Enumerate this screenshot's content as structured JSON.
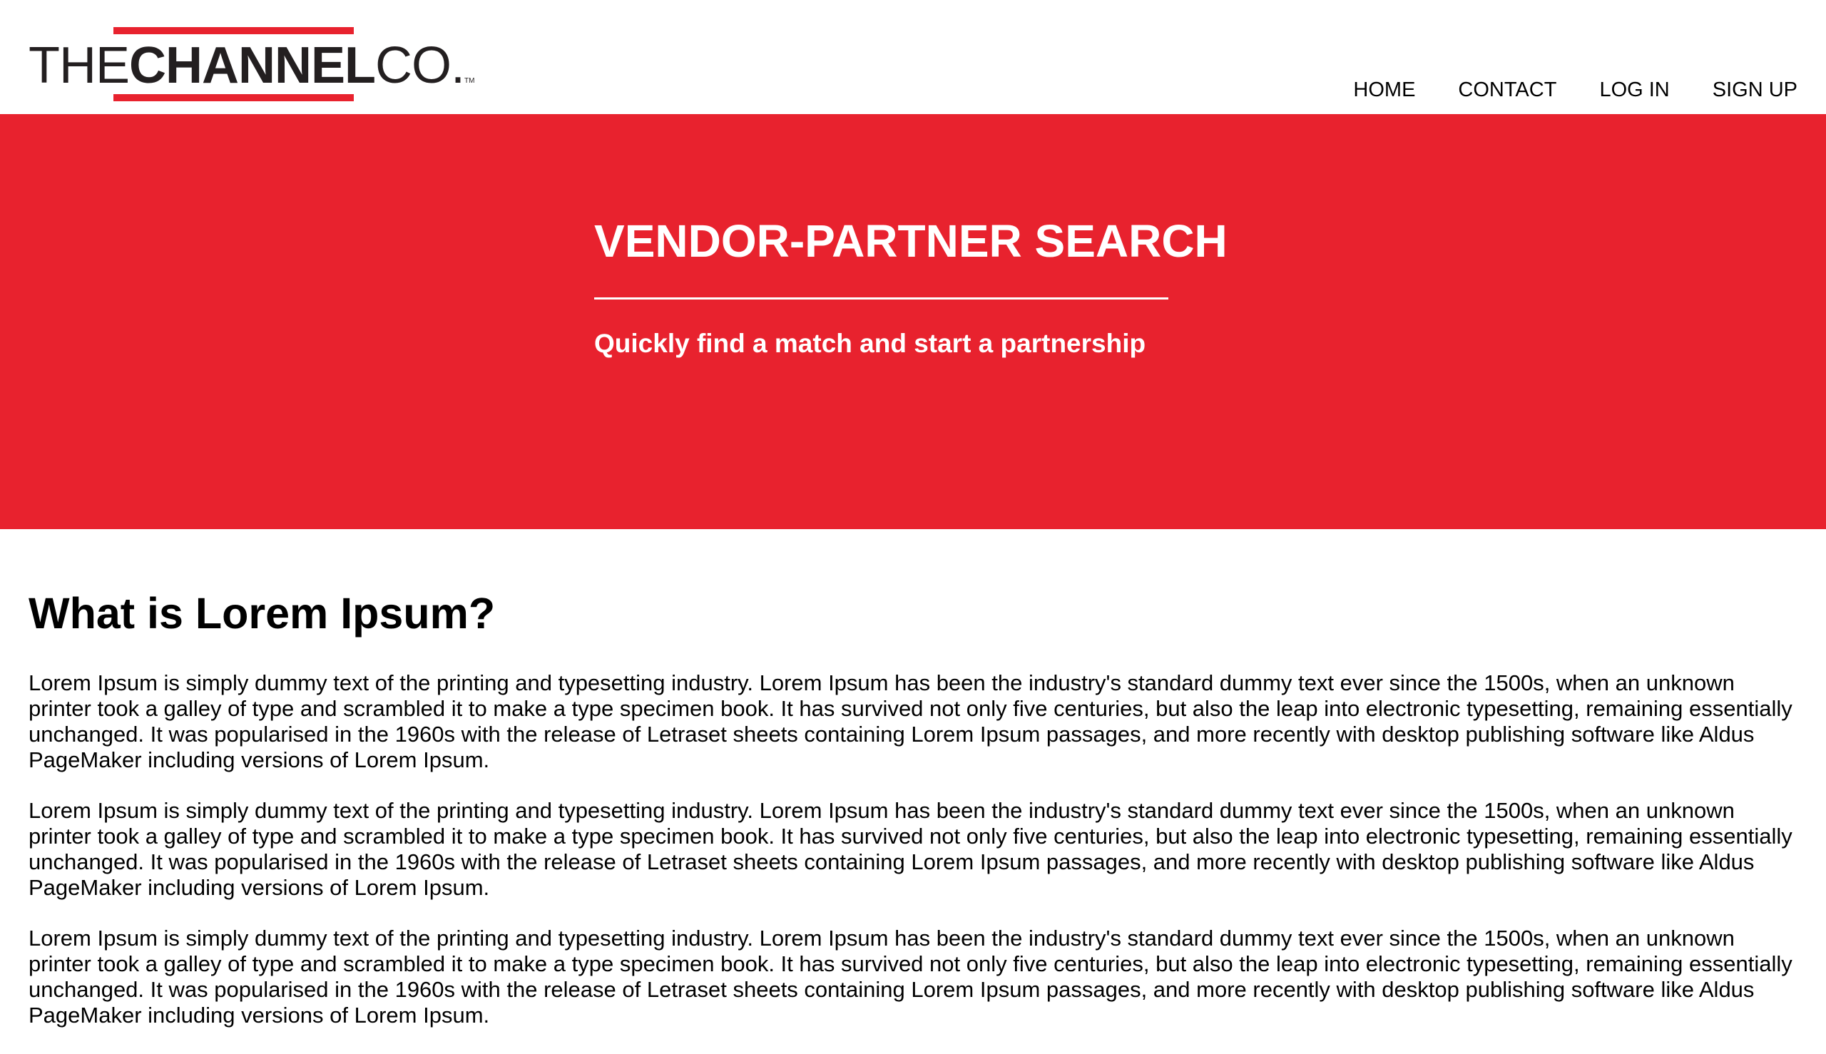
{
  "brand": {
    "logo_the": "THE",
    "logo_channel": "CHANNEL",
    "logo_co": "CO.",
    "logo_tm": "TM",
    "accent_color": "#e8222e"
  },
  "nav": {
    "items": [
      {
        "label": "HOME"
      },
      {
        "label": "CONTACT"
      },
      {
        "label": "LOG IN"
      },
      {
        "label": "SIGN UP"
      }
    ]
  },
  "hero": {
    "title": "VENDOR-PARTNER SEARCH",
    "subtitle": "Quickly find a match and start a partnership"
  },
  "main": {
    "heading": "What is Lorem Ipsum?",
    "paragraphs": [
      "Lorem Ipsum is simply dummy text of the printing and typesetting industry. Lorem Ipsum has been the industry's standard dummy text ever since the 1500s, when an unknown printer took a galley of type and scrambled it to make a type specimen book. It has survived not only five centuries, but also the leap into electronic typesetting, remaining essentially unchanged. It was popularised in the 1960s with the release of Letraset sheets containing Lorem Ipsum passages, and more recently with desktop publishing software like Aldus PageMaker including versions of Lorem Ipsum.",
      "Lorem Ipsum is simply dummy text of the printing and typesetting industry. Lorem Ipsum has been the industry's standard dummy text ever since the 1500s, when an unknown printer took a galley of type and scrambled it to make a type specimen book. It has survived not only five centuries, but also the leap into electronic typesetting, remaining essentially unchanged. It was popularised in the 1960s with the release of Letraset sheets containing Lorem Ipsum passages, and more recently with desktop publishing software like Aldus PageMaker including versions of Lorem Ipsum.",
      "Lorem Ipsum is simply dummy text of the printing and typesetting industry. Lorem Ipsum has been the industry's standard dummy text ever since the 1500s, when an unknown printer took a galley of type and scrambled it to make a type specimen book. It has survived not only five centuries, but also the leap into electronic typesetting, remaining essentially unchanged. It was popularised in the 1960s with the release of Letraset sheets containing Lorem Ipsum passages, and more recently with desktop publishing software like Aldus PageMaker including versions of Lorem Ipsum."
    ]
  }
}
